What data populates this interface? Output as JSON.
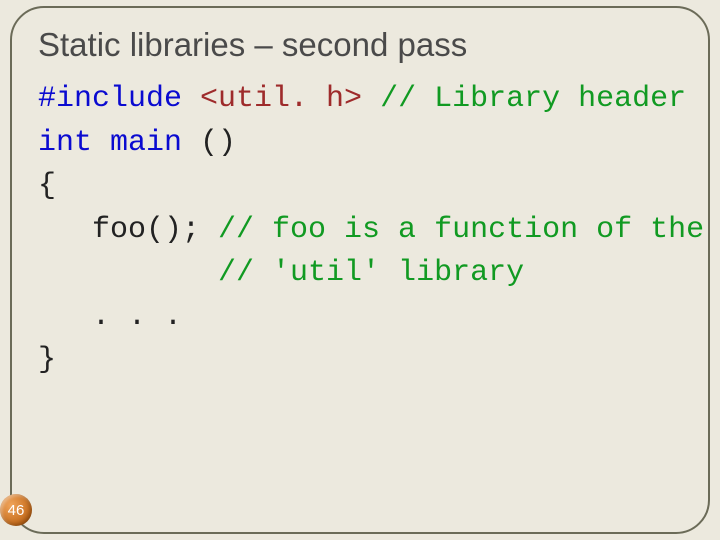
{
  "slide": {
    "title": "Static libraries – second pass",
    "page_number": "46"
  },
  "code": {
    "l1_kw": "#include",
    "l1_inc": " <util. h>",
    "l1_cm": " // Library header",
    "l2_kw1": "int",
    "l2_sp": " ",
    "l2_kw2": "main",
    "l2_tail": " ()",
    "l3": "{",
    "l4_txt": "   foo(); ",
    "l4_cm": "// foo is a function of the",
    "l5_pad": "          ",
    "l5_cm": "// 'util' library",
    "l6": "   . . .",
    "l7": "}"
  }
}
